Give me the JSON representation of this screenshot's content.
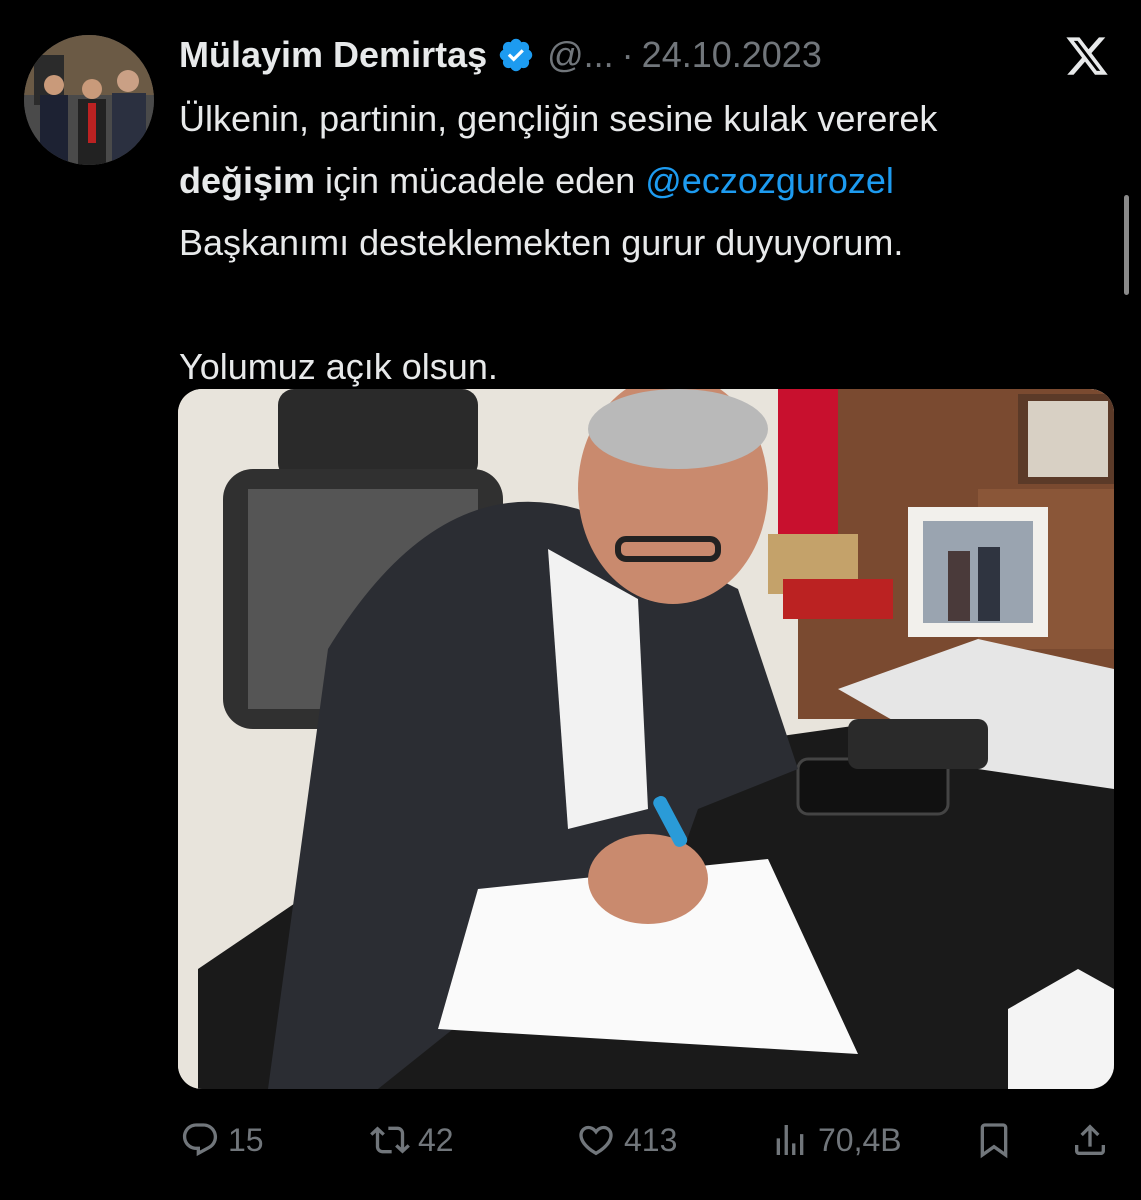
{
  "post": {
    "author_name": "Mülayim Demirtaş",
    "handle": "@...",
    "separator": "·",
    "date": "24.10.2023",
    "text": {
      "line1": "Ülkenin, partinin, gençliğin sesine kulak vererek",
      "bold_word": "değişim",
      "line2_mid": " için mücadele eden ",
      "mention": "@eczozgurozel",
      "line3": "Başkanımı desteklemekten gurur duyuyorum.",
      "line4": "Yolumuz açık olsun."
    }
  },
  "actions": {
    "replies": "15",
    "reposts": "42",
    "likes": "413",
    "views": "70,4B"
  },
  "icons": {
    "verified": "verified-badge-icon",
    "logo": "x-logo-icon",
    "reply": "reply-icon",
    "repost": "repost-icon",
    "like": "heart-icon",
    "views": "views-icon",
    "bookmark": "bookmark-icon",
    "share": "share-icon"
  },
  "colors": {
    "background": "#000000",
    "text": "#e7e9ea",
    "secondary": "#71767b",
    "accent": "#1d9bf0"
  }
}
